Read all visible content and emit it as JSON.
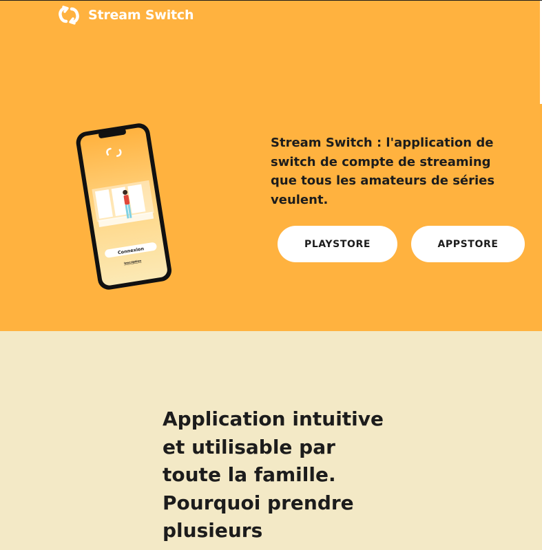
{
  "brand": {
    "name": "Stream Switch",
    "logo_icon": "sync-arrows-icon"
  },
  "hero": {
    "tagline": "Stream Switch : l'application de switch de compte de streaming que tous les amateurs de séries veulent.",
    "playstore_label": "PLAYSTORE",
    "appstore_label": "APPSTORE",
    "phone": {
      "login_button_label": "Connexion",
      "signup_link_label": "Inscription"
    }
  },
  "feature": {
    "title": "Application intuitive et utilisable par toute la famille. Pourquoi prendre plusieurs abonnement et payer"
  },
  "colors": {
    "hero_bg": "#ffb23f",
    "section_bg": "#f3e9c6",
    "text": "#1c1c1c",
    "button_bg": "#ffffff"
  }
}
